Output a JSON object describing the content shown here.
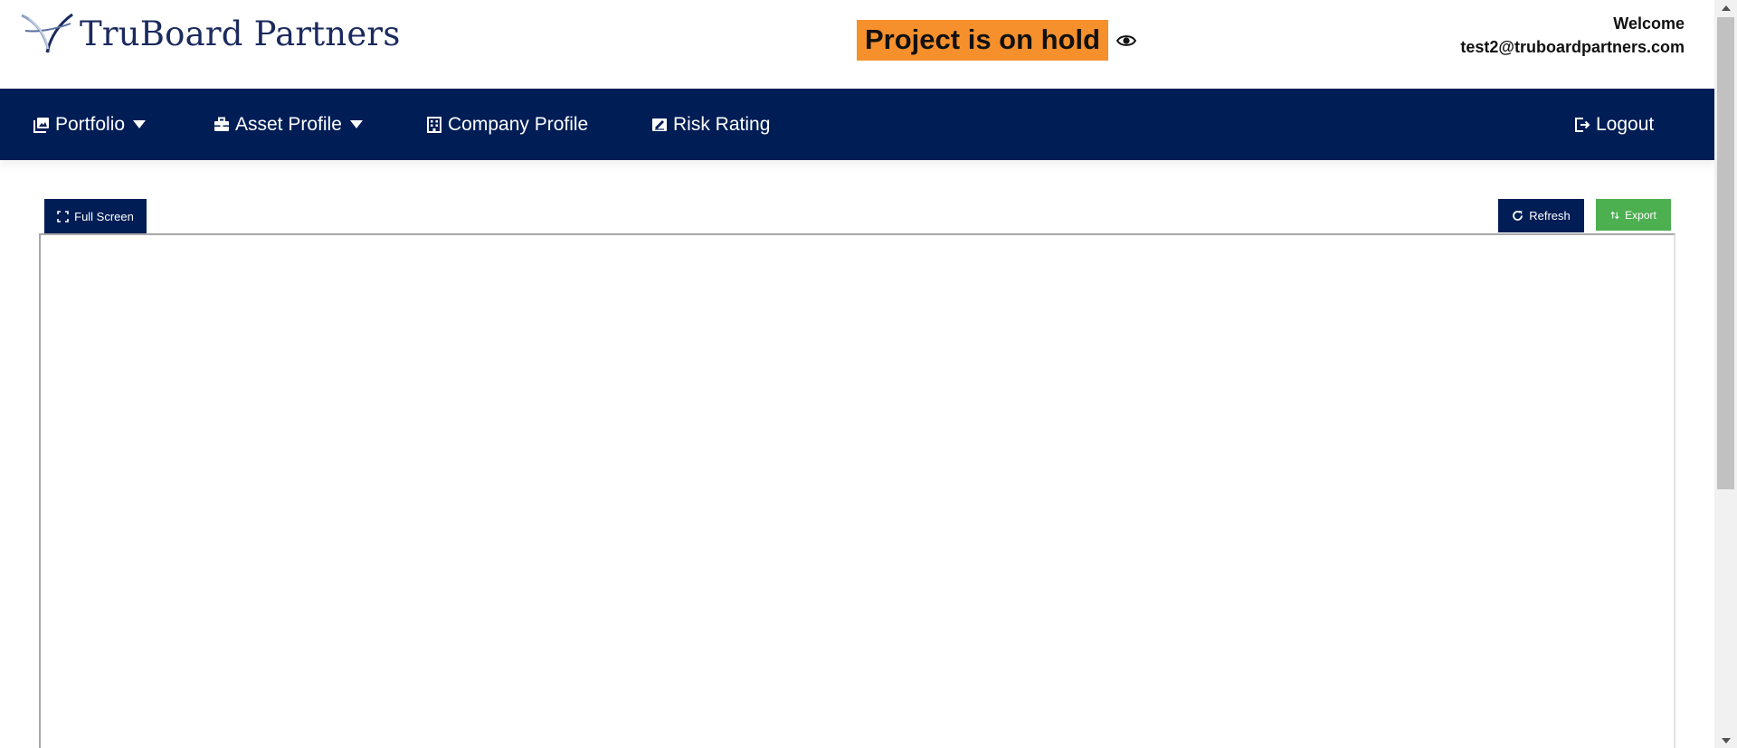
{
  "header": {
    "logo_text": "TruBoard Partners",
    "status_badge": "Project is on hold",
    "welcome_label": "Welcome",
    "user_email": "test2@truboardpartners.com"
  },
  "nav": {
    "items": [
      {
        "label": "Portfolio",
        "icon": "portfolio-icon",
        "dropdown": true
      },
      {
        "label": "Asset Profile",
        "icon": "briefcase-icon",
        "dropdown": true
      },
      {
        "label": "Company Profile",
        "icon": "building-icon",
        "dropdown": false
      },
      {
        "label": "Risk Rating",
        "icon": "signature-icon",
        "dropdown": false
      }
    ],
    "logout_label": "Logout"
  },
  "toolbar": {
    "fullscreen_label": "Full Screen",
    "refresh_label": "Refresh",
    "export_label": "Export"
  },
  "colors": {
    "navy": "#001d56",
    "badge_orange": "#f5902d",
    "export_green": "#4caf50",
    "logo_blue": "#1b2a5e"
  }
}
